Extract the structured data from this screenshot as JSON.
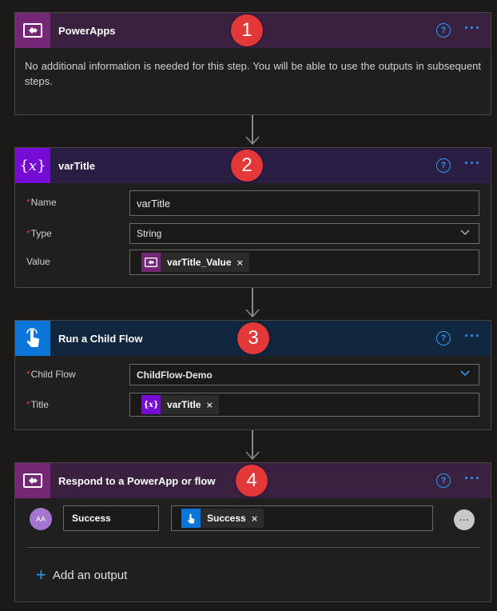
{
  "cards": {
    "powerapps": {
      "title": "PowerApps",
      "badge": "1",
      "message": "No additional information is needed for this step. You will be able to use the outputs in subsequent steps."
    },
    "vartitle": {
      "title": "varTitle",
      "badge": "2",
      "fields": {
        "name_label": "Name",
        "name_value": "varTitle",
        "type_label": "Type",
        "type_value": "String",
        "value_label": "Value",
        "value_token": "varTitle_Value"
      }
    },
    "childflow": {
      "title": "Run a Child Flow",
      "badge": "3",
      "fields": {
        "child_label": "Child Flow",
        "child_value": "ChildFlow-Demo",
        "title_label": "Title",
        "title_token": "varTitle"
      }
    },
    "respond": {
      "title": "Respond to a PowerApp or flow",
      "badge": "4",
      "output_name": "Success",
      "output_token": "Success",
      "avatar": "AA",
      "add_output": "Add an output"
    }
  },
  "icons": {
    "help": "help-circle-icon",
    "more": "more-horizontal-icon",
    "remove": "×",
    "chevron": "chevron-down-icon"
  },
  "colors": {
    "powerapps": "#742774",
    "variable": "#770bd6",
    "flow": "#0b76d9",
    "accent": "#2f96f3",
    "badge": "#e23838"
  }
}
